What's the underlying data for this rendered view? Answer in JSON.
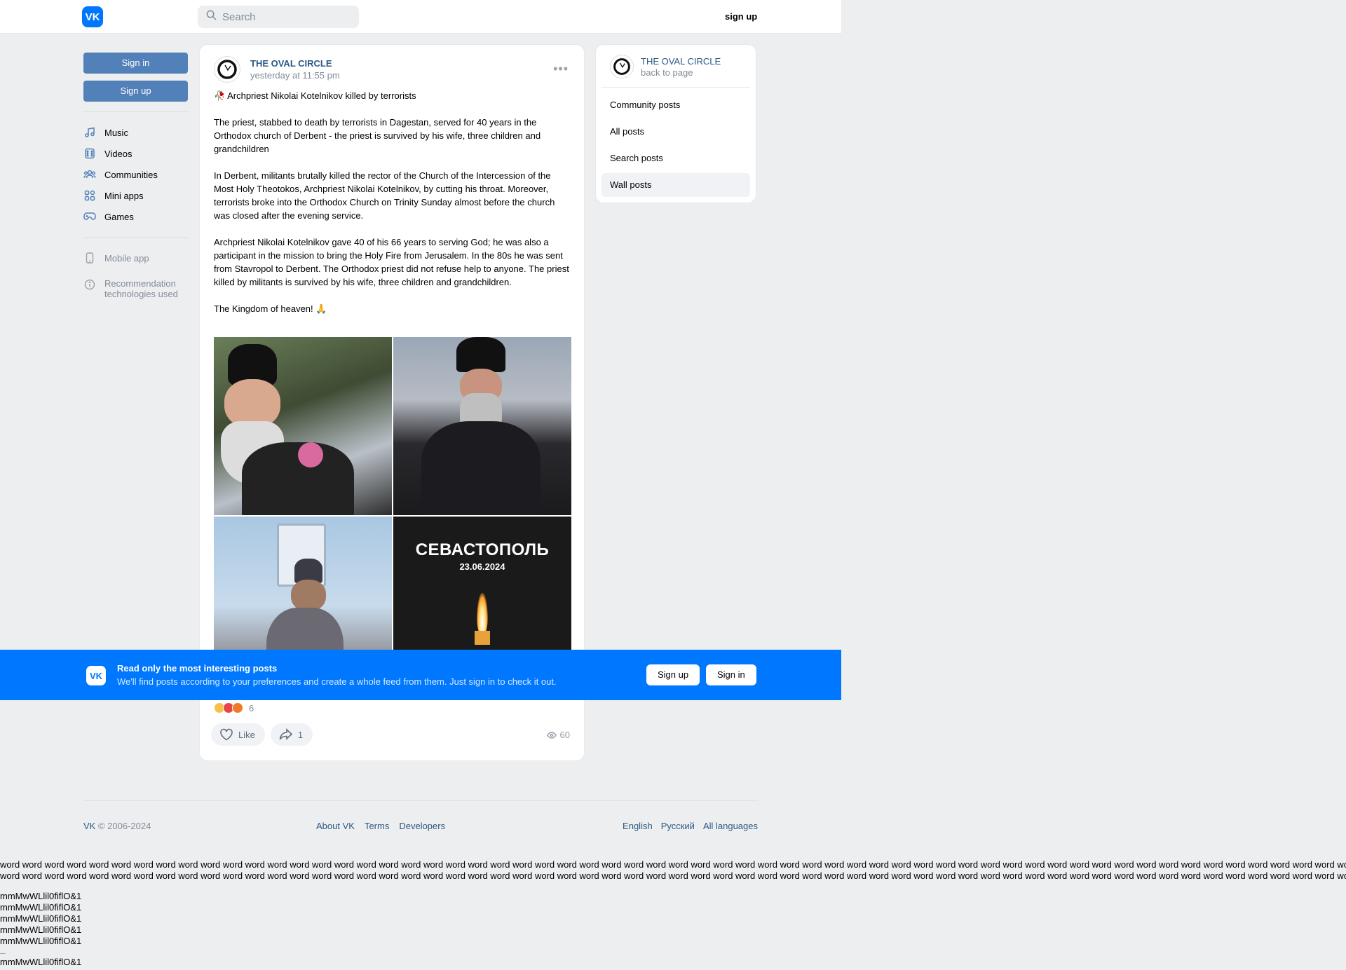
{
  "header": {
    "logo": "VK",
    "search_placeholder": "Search",
    "signup_label": "sign up"
  },
  "sidebar": {
    "sign_in": "Sign in",
    "sign_up": "Sign up",
    "items": [
      {
        "label": "Music",
        "icon": "music-icon"
      },
      {
        "label": "Videos",
        "icon": "video-icon"
      },
      {
        "label": "Communities",
        "icon": "communities-icon"
      },
      {
        "label": "Mini apps",
        "icon": "mini-apps-icon"
      },
      {
        "label": "Games",
        "icon": "games-icon"
      }
    ],
    "mobile_app": "Mobile app",
    "recommendation": "Recommendation technologies used"
  },
  "post": {
    "author": "THE OVAL CIRCLE",
    "time": "yesterday at 11:55 pm",
    "title": "Archpriest Nikolai Kotelnikov killed by terrorists",
    "paragraphs": [
      "The priest, stabbed to death by terrorists in Dagestan, served for 40 years in the Orthodox church of Derbent - the priest is survived by his wife, three children and grandchildren",
      "In Derbent, militants brutally killed the rector of the Church of the Intercession of the Most Holy Theotokos, Archpriest Nikolai Kotelnikov, by cutting his throat. Moreover, terrorists broke into the Orthodox Church on Trinity Sunday almost before the church was closed after the evening service.",
      "Archpriest Nikolai Kotelnikov gave 40 of his 66 years to serving God; he was also a participant in the mission to bring the Holy Fire from Jerusalem. In the 80s he was sent from Stavropol to Derbent. The Orthodox priest did not refuse help to anyone. The priest killed by militants is survived by his wife, three children and grandchildren.",
      "The Kingdom of heaven! 🙏"
    ],
    "photo4_city": "СЕВАСТОПОЛЬ",
    "photo4_date": "23.06.2024",
    "reactions_count": "6",
    "like_label": "Like",
    "share_count": "1",
    "views": "60"
  },
  "right": {
    "title": "THE OVAL CIRCLE",
    "subtitle": "back to page",
    "items": [
      "Community posts",
      "All posts",
      "Search posts",
      "Wall posts"
    ]
  },
  "banner": {
    "title": "Read only the most interesting posts",
    "subtitle": "We'll find posts according to your preferences and create a whole feed from them. Just sign in to check it out.",
    "signup": "Sign up",
    "signin": "Sign in"
  },
  "footer": {
    "brand": "VK",
    "copyright": " © 2006-2024",
    "links": [
      "About VK",
      "Terms",
      "Developers"
    ],
    "langs": [
      "English",
      "Русский",
      "All languages"
    ]
  },
  "filler": {
    "line1": "word word word word word word word word word word word word word word word word word word word word word word word word word word word word word word word word word word word word word word word word word word word word word word word word word word word word word word word word word word word word word word word word word word word word word word word",
    "line2": "word word word word word word word word word word word word word word word word word word word word word word word word word word word word word word word word word word word word word word word word word word word word word word word word word word word word word word word word word word word word word word word word word word word word word word word",
    "glyphs": "mmMwWLlil0fiflO&1"
  },
  "colors": {
    "accent": "#0077ff",
    "button": "#5181b8",
    "link": "#2a5885",
    "muted": "#818c99",
    "background": "#edeef0"
  }
}
